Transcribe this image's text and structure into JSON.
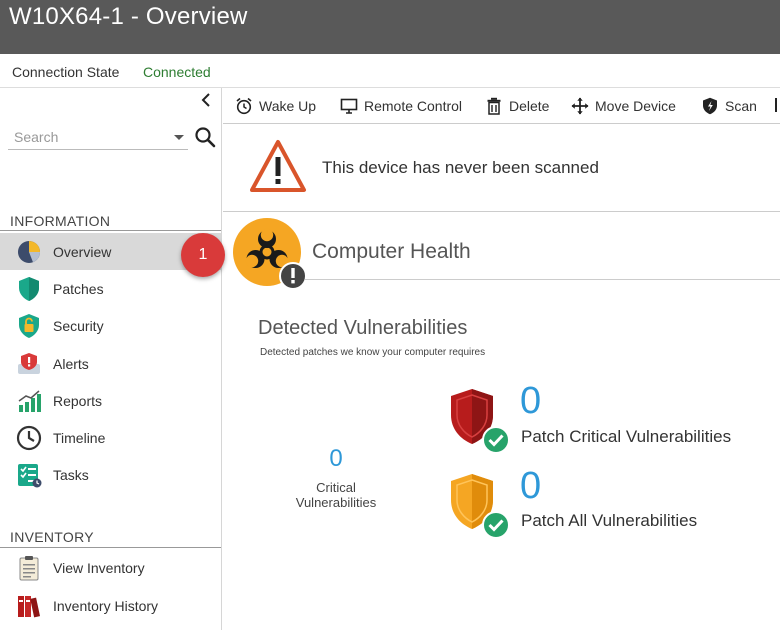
{
  "window": {
    "title": "W10X64-1 - Overview"
  },
  "connection": {
    "label": "Connection State",
    "value": "Connected"
  },
  "sidebar": {
    "search_placeholder": "Search",
    "sections": [
      {
        "title": "INFORMATION",
        "items": [
          {
            "label": "Overview",
            "icon": "pie-chart-icon",
            "active": true
          },
          {
            "label": "Patches",
            "icon": "shield-icon"
          },
          {
            "label": "Security",
            "icon": "lock-shield-icon"
          },
          {
            "label": "Alerts",
            "icon": "alert-icon"
          },
          {
            "label": "Reports",
            "icon": "bar-chart-icon"
          },
          {
            "label": "Timeline",
            "icon": "clock-icon"
          },
          {
            "label": "Tasks",
            "icon": "tasks-icon"
          }
        ]
      },
      {
        "title": "INVENTORY",
        "items": [
          {
            "label": "View Inventory",
            "icon": "clipboard-icon"
          },
          {
            "label": "Inventory History",
            "icon": "binders-icon"
          }
        ]
      }
    ]
  },
  "callout": {
    "number": "1"
  },
  "toolbar": {
    "items": [
      {
        "label": "Wake Up",
        "icon": "alarm-clock-icon"
      },
      {
        "label": "Remote Control",
        "icon": "monitor-icon"
      },
      {
        "label": "Delete",
        "icon": "trash-icon"
      },
      {
        "label": "Move Device",
        "icon": "move-arrows-icon"
      },
      {
        "label": "Scan",
        "icon": "scan-shield-icon"
      }
    ]
  },
  "warning": {
    "text": "This device has never been scanned"
  },
  "health": {
    "title": "Computer Health"
  },
  "vulnerabilities": {
    "title": "Detected Vulnerabilities",
    "subtitle": "Detected patches we know your computer requires",
    "critical": {
      "count": "0",
      "label_line1": "Critical",
      "label_line2": "Vulnerabilities"
    },
    "patch_critical": {
      "count": "0",
      "label": "Patch Critical Vulnerabilities"
    },
    "patch_all": {
      "count": "0",
      "label": "Patch All Vulnerabilities"
    }
  },
  "colors": {
    "title_bar": "#595959",
    "connected": "#2e7d32",
    "accent_blue": "#2e98d8",
    "critical_red": "#b71c1c",
    "warning_orange": "#f5a623",
    "check_green": "#27a36a",
    "badge_red": "#d93a3a"
  }
}
